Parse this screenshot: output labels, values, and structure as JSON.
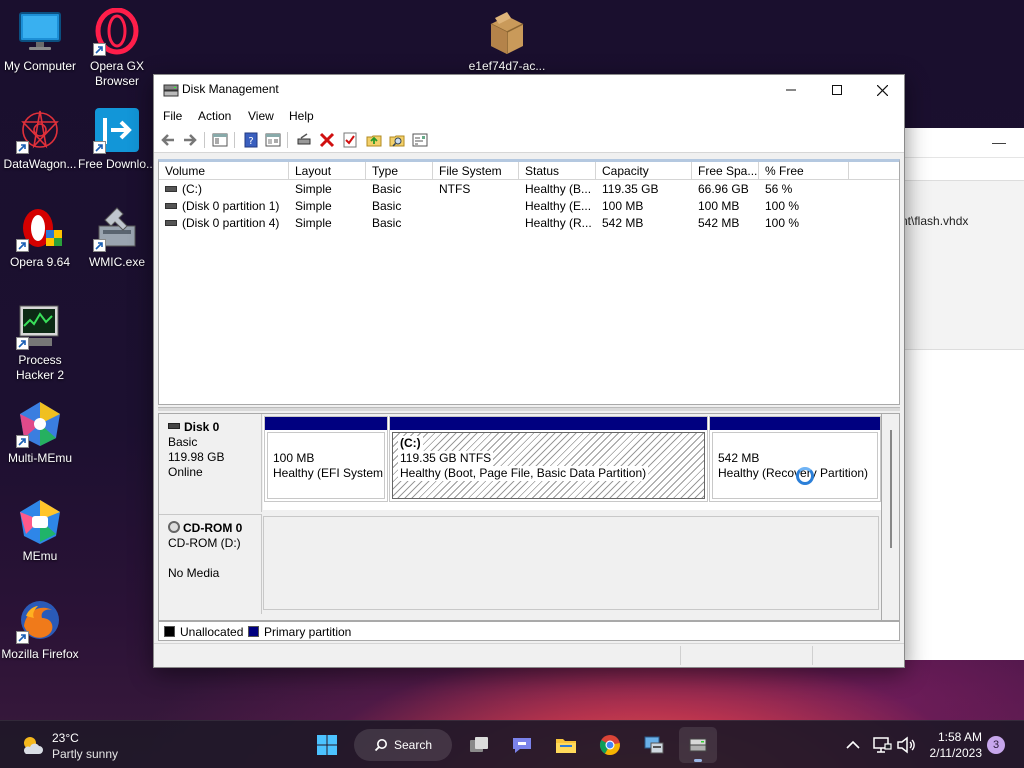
{
  "desktop": {
    "icons": [
      {
        "label": "My Computer"
      },
      {
        "label": "Opera GX Browser"
      },
      {
        "label": "e1ef74d7-ac..."
      },
      {
        "label": "DataWagon..."
      },
      {
        "label": "Free Downlo..."
      },
      {
        "label": "Opera 9.64"
      },
      {
        "label": "WMIC.exe"
      },
      {
        "label": "Process Hacker 2"
      },
      {
        "label": "Multi-MEmu"
      },
      {
        "label": "MEmu"
      },
      {
        "label": "Mozilla Firefox"
      }
    ]
  },
  "background_window": {
    "path_fragment": "nt\\flash.vhdx",
    "minimize_glyph": "—"
  },
  "window": {
    "title": "Disk Management",
    "menu": [
      "File",
      "Action",
      "View",
      "Help"
    ],
    "toolbar_icons": [
      "back-arrow-icon",
      "forward-arrow-icon",
      "console-tree-icon",
      "help-icon",
      "properties-icon",
      "connect-disk-icon",
      "delete-icon",
      "checkmark-icon",
      "up-folder-icon",
      "search-folder-icon",
      "settings-panel-icon"
    ],
    "volume_list": {
      "columns": [
        "Volume",
        "Layout",
        "Type",
        "File System",
        "Status",
        "Capacity",
        "Free Spa...",
        "% Free"
      ],
      "rows": [
        {
          "volume": "(C:)",
          "layout": "Simple",
          "type": "Basic",
          "fs": "NTFS",
          "status": "Healthy (B...",
          "capacity": "119.35 GB",
          "free": "66.96 GB",
          "pct": "56 %"
        },
        {
          "volume": "(Disk 0 partition 1)",
          "layout": "Simple",
          "type": "Basic",
          "fs": "",
          "status": "Healthy (E...",
          "capacity": "100 MB",
          "free": "100 MB",
          "pct": "100 %"
        },
        {
          "volume": "(Disk 0 partition 4)",
          "layout": "Simple",
          "type": "Basic",
          "fs": "",
          "status": "Healthy (R...",
          "capacity": "542 MB",
          "free": "542 MB",
          "pct": "100 %"
        }
      ]
    },
    "disks": [
      {
        "name": "Disk 0",
        "type": "Basic",
        "size": "119.98 GB",
        "state": "Online",
        "partitions": [
          {
            "title": "",
            "size": "100 MB",
            "status": "Healthy (EFI System I"
          },
          {
            "title": "(C:)",
            "size": "119.35 GB NTFS",
            "status": "Healthy (Boot, Page File, Basic Data Partition)"
          },
          {
            "title": "",
            "size": "542 MB",
            "status": "Healthy (Recovery Partition)"
          }
        ]
      },
      {
        "name": "CD-ROM 0",
        "type": "CD-ROM (D:)",
        "state": "No Media"
      }
    ],
    "legend": [
      {
        "label": "Unallocated",
        "color": "#000000"
      },
      {
        "label": "Primary partition",
        "color": "#000080"
      }
    ]
  },
  "taskbar": {
    "weather": {
      "temp": "23°C",
      "condition": "Partly sunny"
    },
    "search_label": "Search",
    "clock": {
      "time": "1:58 AM",
      "date": "2/11/2023"
    },
    "notification_count": "3"
  }
}
